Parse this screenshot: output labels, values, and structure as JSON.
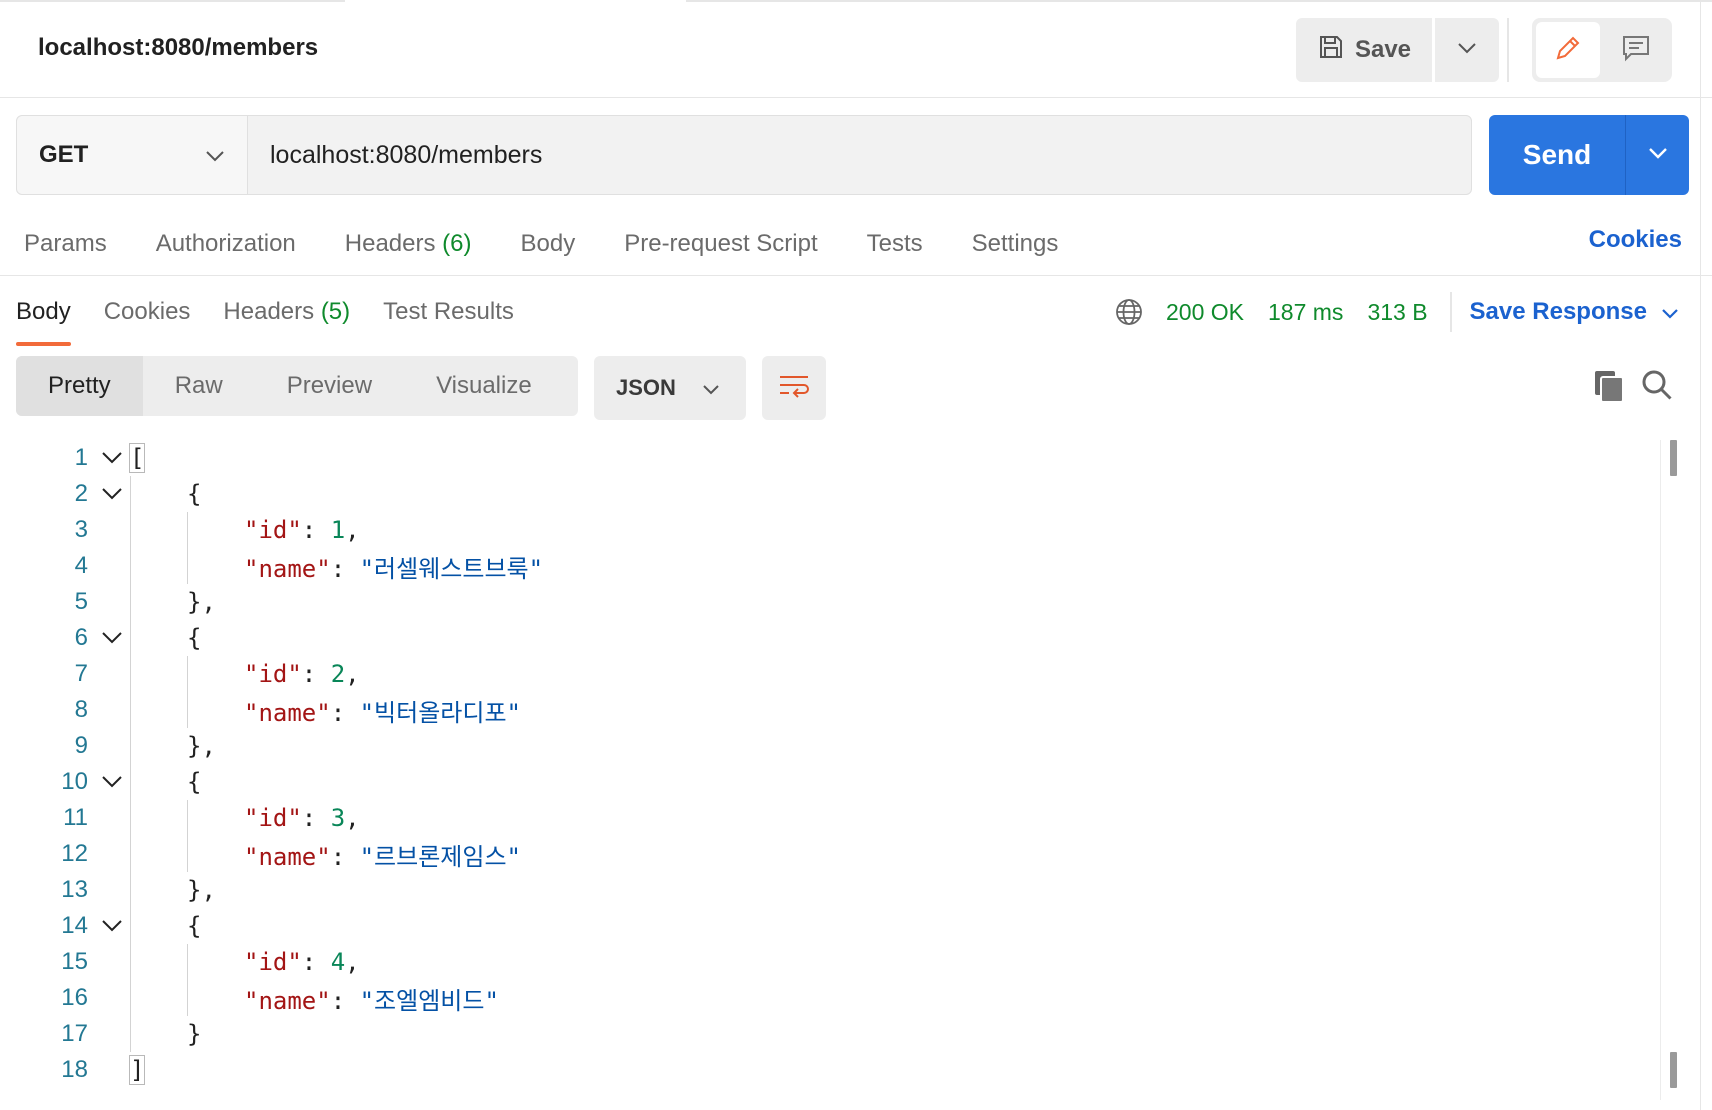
{
  "request": {
    "title": "localhost:8080/members",
    "method": "GET",
    "url": "localhost:8080/members"
  },
  "toolbar": {
    "save_label": "Save",
    "send_label": "Send"
  },
  "request_tabs": [
    {
      "label": "Params",
      "count": ""
    },
    {
      "label": "Authorization",
      "count": ""
    },
    {
      "label": "Headers",
      "count": "(6)"
    },
    {
      "label": "Body",
      "count": ""
    },
    {
      "label": "Pre-request Script",
      "count": ""
    },
    {
      "label": "Tests",
      "count": ""
    },
    {
      "label": "Settings",
      "count": ""
    }
  ],
  "cookies_link": "Cookies",
  "response_tabs": [
    {
      "label": "Body",
      "count": "",
      "active": true
    },
    {
      "label": "Cookies",
      "count": "",
      "active": false
    },
    {
      "label": "Headers",
      "count": "(5)",
      "active": false
    },
    {
      "label": "Test Results",
      "count": "",
      "active": false
    }
  ],
  "response_meta": {
    "status": "200 OK",
    "time": "187 ms",
    "size": "313 B",
    "save_response": "Save Response"
  },
  "view_modes": [
    "Pretty",
    "Raw",
    "Preview",
    "Visualize"
  ],
  "active_view_mode": "Pretty",
  "format": "JSON",
  "colors": {
    "accent_blue": "#2a76e0",
    "status_green": "#0f8a2c",
    "tab_underline": "#f26b3a",
    "json_key": "#a31515",
    "json_string": "#0451a5",
    "json_number": "#098658",
    "line_number": "#237893"
  },
  "icons": {
    "save": "floppy-disk-icon",
    "edit": "pencil-icon",
    "comments": "comment-icon",
    "globe": "globe-icon",
    "wrap": "wrap-lines-icon",
    "copy": "copy-icon",
    "search": "search-icon"
  },
  "response_body": {
    "lines": [
      {
        "n": "1",
        "fold": true,
        "indent": 0,
        "text": "[",
        "kind": "open"
      },
      {
        "n": "2",
        "fold": true,
        "indent": 1,
        "text": "{",
        "kind": "punct"
      },
      {
        "n": "3",
        "fold": false,
        "indent": 2,
        "key": "\"id\"",
        "sep": ": ",
        "value": "1",
        "vtype": "num",
        "trail": ","
      },
      {
        "n": "4",
        "fold": false,
        "indent": 2,
        "key": "\"name\"",
        "sep": ": ",
        "value": "\"러셀웨스트브룩\"",
        "vtype": "str",
        "trail": ""
      },
      {
        "n": "5",
        "fold": false,
        "indent": 1,
        "text": "},",
        "kind": "punct"
      },
      {
        "n": "6",
        "fold": true,
        "indent": 1,
        "text": "{",
        "kind": "punct"
      },
      {
        "n": "7",
        "fold": false,
        "indent": 2,
        "key": "\"id\"",
        "sep": ": ",
        "value": "2",
        "vtype": "num",
        "trail": ","
      },
      {
        "n": "8",
        "fold": false,
        "indent": 2,
        "key": "\"name\"",
        "sep": ": ",
        "value": "\"빅터올라디포\"",
        "vtype": "str",
        "trail": ""
      },
      {
        "n": "9",
        "fold": false,
        "indent": 1,
        "text": "},",
        "kind": "punct"
      },
      {
        "n": "10",
        "fold": true,
        "indent": 1,
        "text": "{",
        "kind": "punct"
      },
      {
        "n": "11",
        "fold": false,
        "indent": 2,
        "key": "\"id\"",
        "sep": ": ",
        "value": "3",
        "vtype": "num",
        "trail": ","
      },
      {
        "n": "12",
        "fold": false,
        "indent": 2,
        "key": "\"name\"",
        "sep": ": ",
        "value": "\"르브론제임스\"",
        "vtype": "str",
        "trail": ""
      },
      {
        "n": "13",
        "fold": false,
        "indent": 1,
        "text": "},",
        "kind": "punct"
      },
      {
        "n": "14",
        "fold": true,
        "indent": 1,
        "text": "{",
        "kind": "punct"
      },
      {
        "n": "15",
        "fold": false,
        "indent": 2,
        "key": "\"id\"",
        "sep": ": ",
        "value": "4",
        "vtype": "num",
        "trail": ","
      },
      {
        "n": "16",
        "fold": false,
        "indent": 2,
        "key": "\"name\"",
        "sep": ": ",
        "value": "\"조엘엠비드\"",
        "vtype": "str",
        "trail": ""
      },
      {
        "n": "17",
        "fold": false,
        "indent": 1,
        "text": "}",
        "kind": "punct"
      },
      {
        "n": "18",
        "fold": false,
        "indent": 0,
        "text": "]",
        "kind": "close"
      }
    ]
  }
}
